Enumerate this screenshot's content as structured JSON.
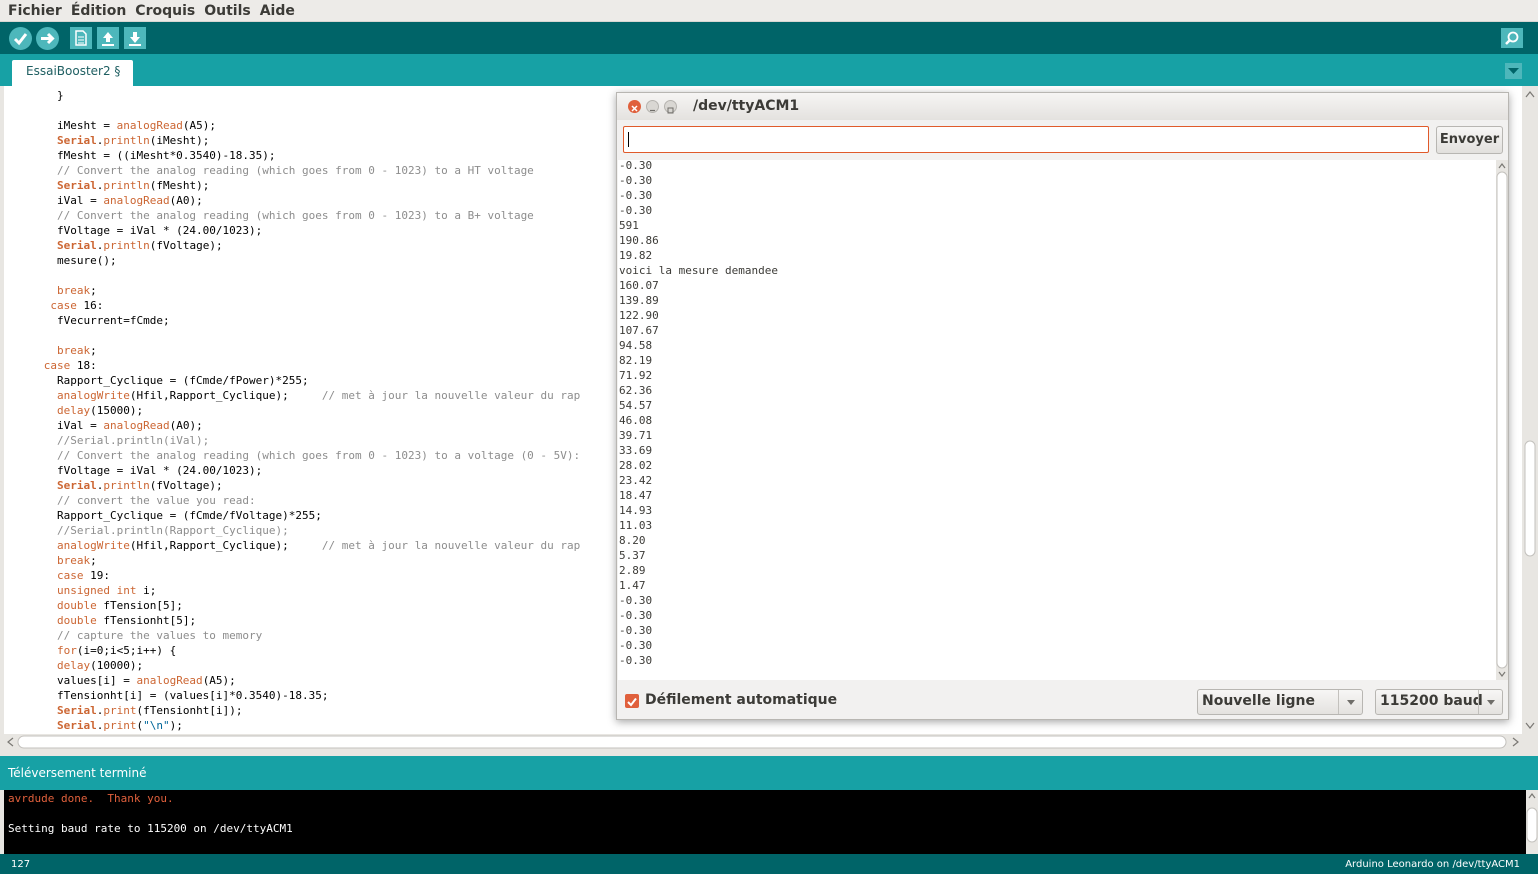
{
  "menu": {
    "items": [
      "Fichier",
      "Édition",
      "Croquis",
      "Outils",
      "Aide"
    ]
  },
  "toolbar": {
    "buttons": [
      {
        "name": "verify",
        "icon": "check-icon"
      },
      {
        "name": "upload",
        "icon": "arrow-right-icon"
      },
      {
        "name": "new",
        "icon": "new-file-icon"
      },
      {
        "name": "open",
        "icon": "open-up-arrow-icon"
      },
      {
        "name": "save",
        "icon": "save-down-arrow-icon"
      }
    ],
    "serial_monitor_icon": "magnifier-icon"
  },
  "tab": {
    "label": "EssaiBooster2 §"
  },
  "editor": {
    "lines": [
      "        }",
      "",
      "        iMesht = analogRead(A5);",
      "        Serial.println(iMesht);",
      "        fMesht = ((iMesht*0.3540)-18.35);",
      "        // Convert the analog reading (which goes from 0 - 1023) to a HT voltage",
      "        Serial.println(fMesht);",
      "        iVal = analogRead(A0);",
      "        // Convert the analog reading (which goes from 0 - 1023) to a B+ voltage",
      "        fVoltage = iVal * (24.00/1023);",
      "        Serial.println(fVoltage);",
      "        mesure();",
      "",
      "        break;",
      "       case 16:",
      "        fVecurrent=fCmde;",
      "",
      "        break;",
      "      case 18:",
      "        Rapport_Cyclique = (fCmde/fPower)*255;",
      "        analogWrite(Hfil,Rapport_Cyclique);     // met à jour la nouvelle valeur du rap",
      "        delay(15000);",
      "        iVal = analogRead(A0);",
      "        //Serial.println(iVal);",
      "        // Convert the analog reading (which goes from 0 - 1023) to a voltage (0 - 5V):",
      "        fVoltage = iVal * (24.00/1023);",
      "        Serial.println(fVoltage);",
      "        // convert the value you read:",
      "        Rapport_Cyclique = (fCmde/fVoltage)*255;",
      "        //Serial.println(Rapport_Cyclique);",
      "        analogWrite(Hfil,Rapport_Cyclique);     // met à jour la nouvelle valeur du rap",
      "        break;",
      "        case 19:",
      "        unsigned int i;",
      "        double fTension[5];",
      "        double fTensionht[5];",
      "        // capture the values to memory",
      "        for(i=0;i<5;i++) {",
      "        delay(10000);",
      "        values[i] = analogRead(A5);",
      "        fTensionht[i] = (values[i]*0.3540)-18.35;",
      "        Serial.print(fTensionht[i]);",
      "        Serial.print(\"\\n\");"
    ]
  },
  "status": {
    "message": "Téléversement terminé"
  },
  "console": {
    "lines": [
      {
        "text": "avrdude done.  Thank you.",
        "color": "#e0603c"
      },
      {
        "text": "",
        "color": "#ffffff"
      },
      {
        "text": "Setting baud rate to 115200 on /dev/ttyACM1",
        "color": "#ffffff"
      }
    ]
  },
  "footer": {
    "line_number": "127",
    "board": "Arduino Leonardo on /dev/ttyACM1"
  },
  "serial_monitor": {
    "title": "/dev/ttyACM1",
    "input_value": "",
    "send_label": "Envoyer",
    "output_lines": [
      "-0.30",
      "-0.30",
      "-0.30",
      "-0.30",
      "591",
      "190.86",
      "19.82",
      "voici la mesure demandee",
      "160.07",
      "139.89",
      "122.90",
      "107.67",
      "94.58",
      "82.19",
      "71.92",
      "62.36",
      "54.57",
      "46.08",
      "39.71",
      "33.69",
      "28.02",
      "23.42",
      "18.47",
      "14.93",
      "11.03",
      "8.20",
      "5.37",
      "2.89",
      "1.47",
      "-0.30",
      "-0.30",
      "-0.30",
      "-0.30",
      "-0.30"
    ],
    "autoscroll_label": "Défilement automatique",
    "autoscroll_checked": true,
    "line_ending": "Nouvelle ligne",
    "baud_rate": "115200 baud"
  },
  "colors": {
    "toolbar_bg": "#006468",
    "tab_bar_bg": "#17a1a5",
    "button_fill": "#4db7bb",
    "keyword": "#cc6633",
    "comment": "#8d8d8d",
    "error_text": "#e0603c",
    "accent": "#e0603c"
  }
}
